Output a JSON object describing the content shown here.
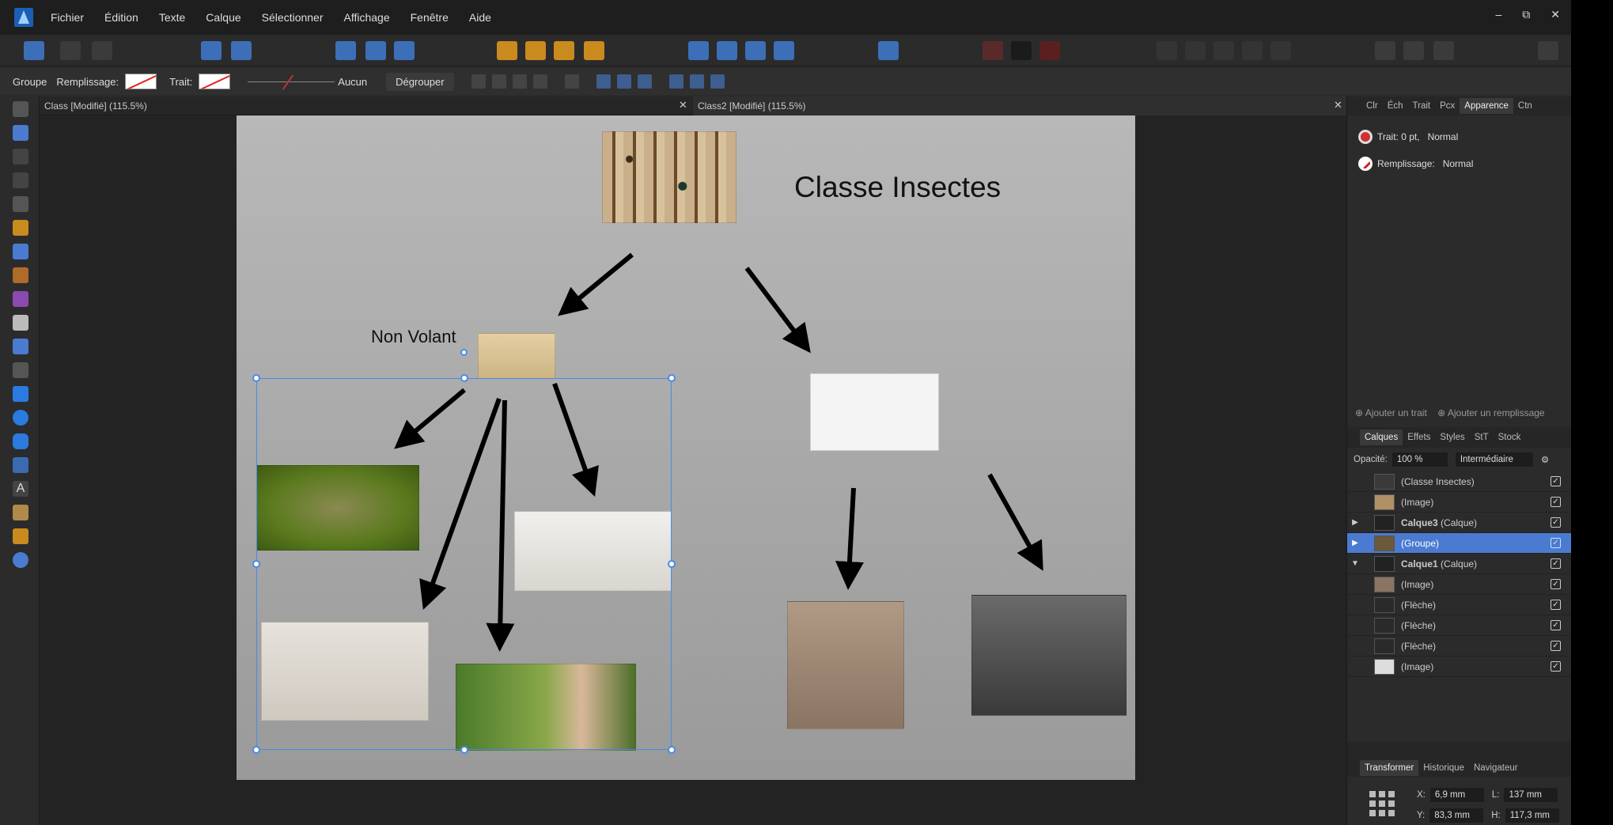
{
  "menubar": {
    "items": [
      "Fichier",
      "Édition",
      "Texte",
      "Calque",
      "Sélectionner",
      "Affichage",
      "Fenêtre",
      "Aide"
    ],
    "window_controls": [
      "–",
      "⧉",
      "✕"
    ]
  },
  "context_bar": {
    "mode": "Groupe",
    "fill_label": "Remplissage:",
    "stroke_label": "Trait:",
    "stroke_style": "Aucun",
    "ungroup_button": "Dégrouper"
  },
  "tabs": [
    {
      "label": "Class [Modifié] (115.5%)"
    },
    {
      "label": "Class2 [Modifié] (115.5%)"
    }
  ],
  "canvas": {
    "title": "Classe Insectes",
    "label": "Non Volant",
    "background_top": "#b8b8b8",
    "background_bottom": "#9a9a9a"
  },
  "right_panel": {
    "top_tabs": [
      "Clr",
      "Éch",
      "Trait",
      "Pcx",
      "Apparence",
      "Ctn"
    ],
    "active_top_tab": "Apparence",
    "appearance": {
      "stroke": {
        "label": "Trait: 0 pt,",
        "mode": "Normal"
      },
      "fill": {
        "label": "Remplissage:",
        "mode": "Normal"
      }
    },
    "add_stroke": "Ajouter un trait",
    "add_fill": "Ajouter un remplissage",
    "layer_tabs": [
      "Calques",
      "Effets",
      "Styles",
      "StT",
      "Stock"
    ],
    "active_layer_tab": "Calques",
    "opacity_label": "Opacité:",
    "opacity_value": "100 %",
    "blend_mode": "Intermédiaire",
    "layers": [
      {
        "name": "(Classe Insectes)",
        "bold": "",
        "expander": "",
        "selected": false
      },
      {
        "name": "(Image)",
        "bold": "",
        "expander": "",
        "selected": false
      },
      {
        "name": "(Calque)",
        "bold": "Calque3",
        "expander": "▶",
        "selected": false
      },
      {
        "name": "(Groupe)",
        "bold": "",
        "expander": "▶",
        "selected": true
      },
      {
        "name": "(Calque)",
        "bold": "Calque1",
        "expander": "▼",
        "selected": false
      },
      {
        "name": "(Image)",
        "bold": "",
        "expander": "",
        "selected": false
      },
      {
        "name": "(Flèche)",
        "bold": "",
        "expander": "",
        "selected": false
      },
      {
        "name": "(Flèche)",
        "bold": "",
        "expander": "",
        "selected": false
      },
      {
        "name": "(Flèche)",
        "bold": "",
        "expander": "",
        "selected": false
      },
      {
        "name": "(Image)",
        "bold": "",
        "expander": "",
        "selected": false
      }
    ],
    "transform_tabs": [
      "Transformer",
      "Historique",
      "Navigateur"
    ],
    "active_transform_tab": "Transformer",
    "transform": {
      "x_label": "X:",
      "x_value": "6,9 mm",
      "y_label": "Y:",
      "y_value": "83,3 mm",
      "w_label": "L:",
      "w_value": "137 mm",
      "h_label": "H:",
      "h_value": "117,3 mm"
    }
  },
  "colors": {
    "accent": "#4a8ae8",
    "selection_row": "#4a7bd0",
    "brand": "#1a5fb4"
  }
}
